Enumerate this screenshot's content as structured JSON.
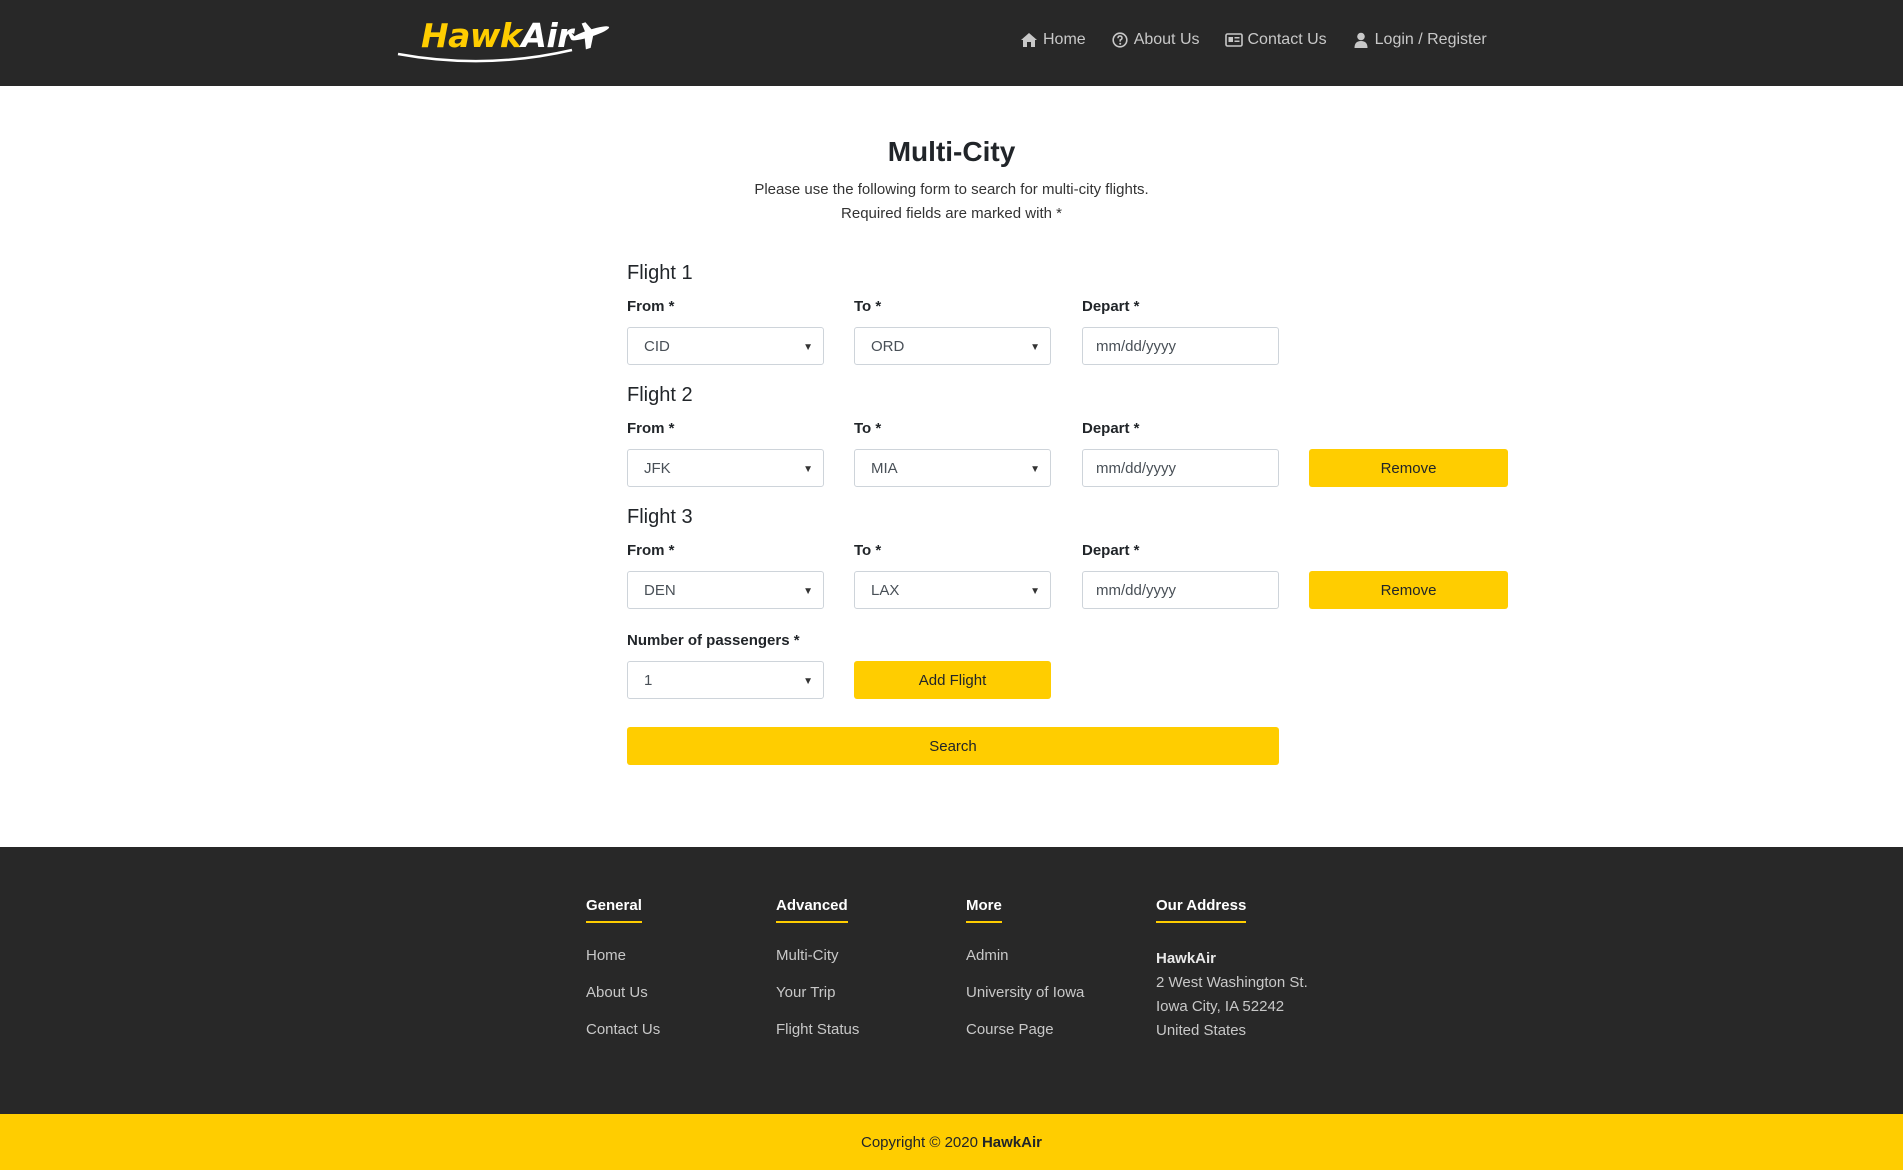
{
  "brand": {
    "name_part1": "Hawk",
    "name_part2": "Air",
    "accent": "#FFCD00",
    "dark": "#282828"
  },
  "nav": {
    "items": [
      {
        "label": "Home",
        "icon": "home-icon"
      },
      {
        "label": "About Us",
        "icon": "question-circle-icon"
      },
      {
        "label": "Contact Us",
        "icon": "id-card-icon"
      },
      {
        "label": "Login / Register",
        "icon": "user-icon"
      }
    ]
  },
  "page": {
    "title": "Multi-City",
    "intro_line1": "Please use the following form to search for multi-city flights.",
    "intro_line2": "Required fields are marked with *"
  },
  "form": {
    "from_label": "From *",
    "to_label": "To *",
    "depart_label": "Depart *",
    "date_placeholder": "mm/dd/yyyy",
    "remove_label": "Remove",
    "flights": [
      {
        "heading": "Flight 1",
        "from": "CID",
        "to": "ORD"
      },
      {
        "heading": "Flight 2",
        "from": "JFK",
        "to": "MIA"
      },
      {
        "heading": "Flight 3",
        "from": "DEN",
        "to": "LAX"
      }
    ],
    "passengers_label": "Number of passengers *",
    "passengers_value": "1",
    "add_flight_label": "Add Flight",
    "search_label": "Search"
  },
  "footer": {
    "general": {
      "heading": "General",
      "links": [
        "Home",
        "About Us",
        "Contact Us"
      ]
    },
    "advanced": {
      "heading": "Advanced",
      "links": [
        "Multi-City",
        "Your Trip",
        "Flight Status"
      ]
    },
    "more": {
      "heading": "More",
      "links": [
        "Admin",
        "University of Iowa",
        "Course Page"
      ]
    },
    "address": {
      "heading": "Our Address",
      "name": "HawkAir",
      "line1": "2 West Washington St.",
      "line2": "Iowa City, IA 52242",
      "line3": "United States"
    },
    "copyright_prefix": "Copyright © 2020",
    "copyright_brand": "HawkAir"
  }
}
